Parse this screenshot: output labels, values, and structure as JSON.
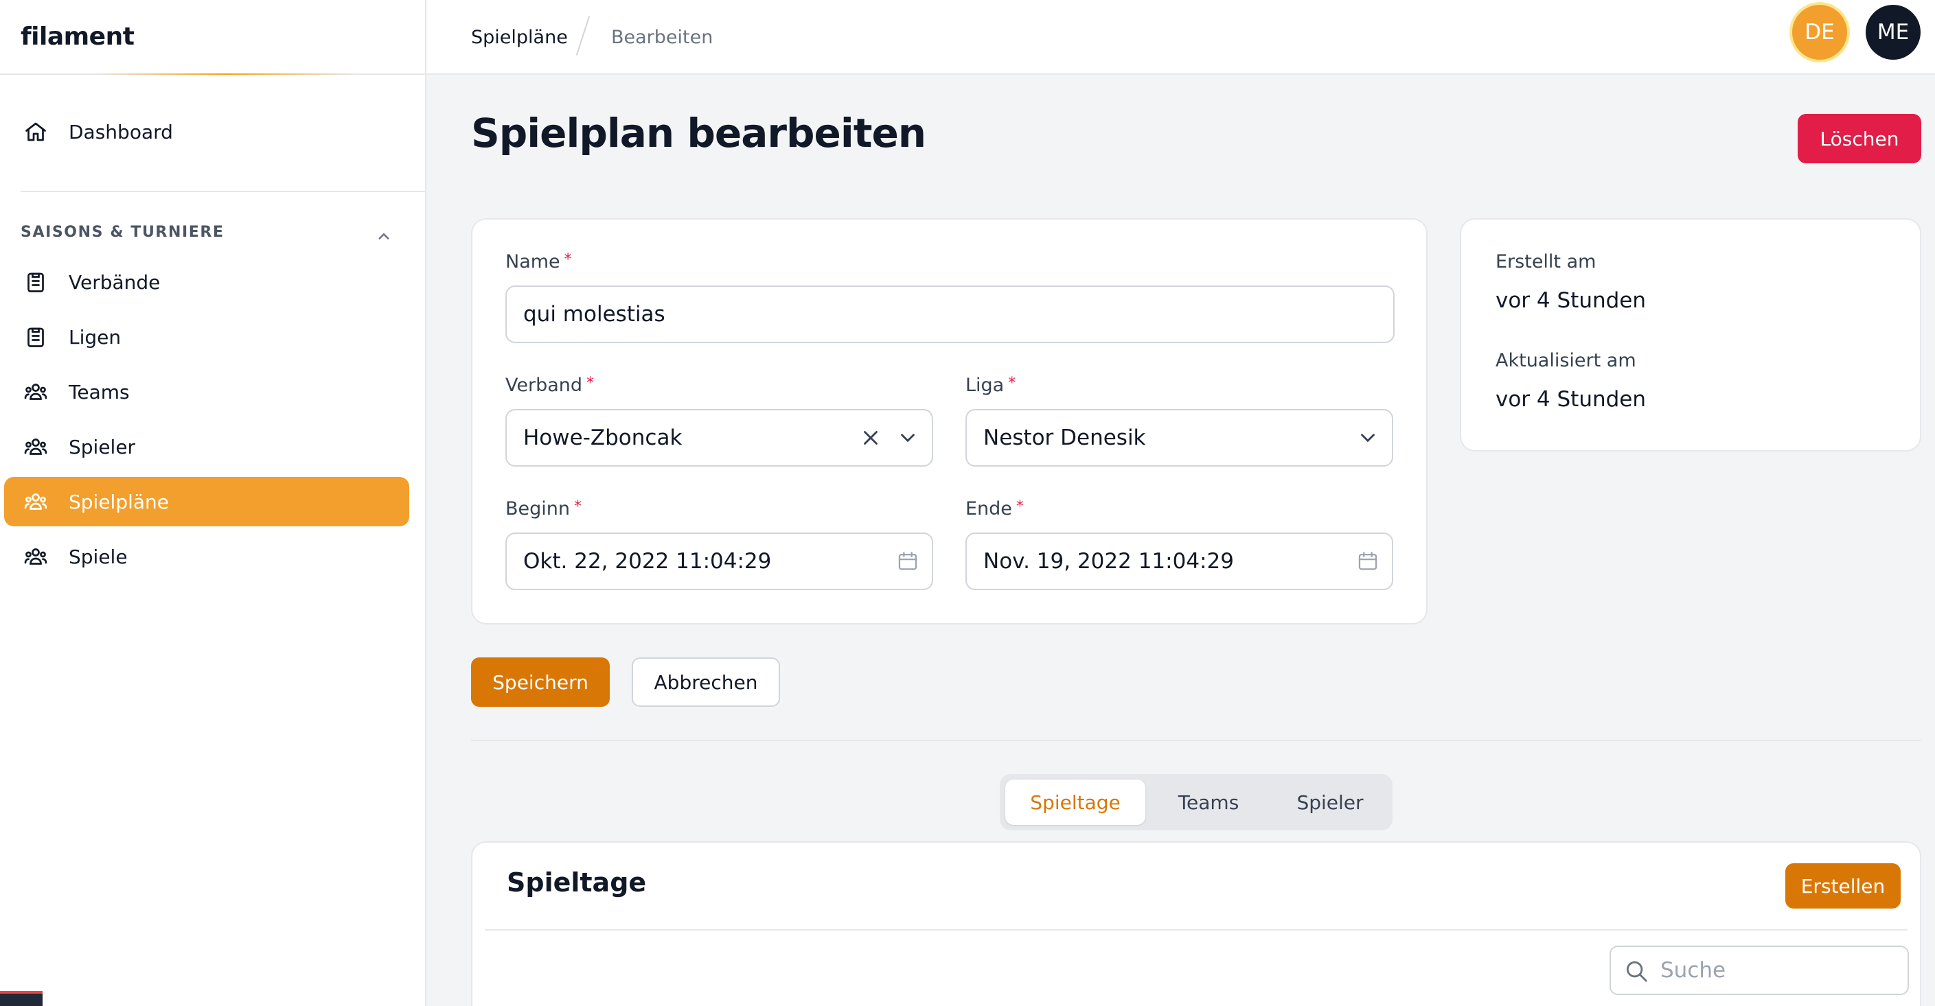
{
  "brand": "filament",
  "sidebar": {
    "dashboard": "Dashboard",
    "group_label": "SAISONS & TURNIERE",
    "items": [
      {
        "label": "Verbände",
        "icon": "clipboard-list-icon"
      },
      {
        "label": "Ligen",
        "icon": "clipboard-list-icon"
      },
      {
        "label": "Teams",
        "icon": "user-group-icon"
      },
      {
        "label": "Spieler",
        "icon": "user-group-icon"
      },
      {
        "label": "Spielpläne",
        "icon": "user-group-icon",
        "active": true
      },
      {
        "label": "Spiele",
        "icon": "user-group-icon"
      }
    ]
  },
  "breadcrumb": {
    "first": "Spielpläne",
    "second": "Bearbeiten"
  },
  "user_menu": {
    "de": "DE",
    "me": "ME"
  },
  "page": {
    "title": "Spielplan bearbeiten",
    "delete_label": "Löschen"
  },
  "form": {
    "name": {
      "label": "Name",
      "value": "qui molestias"
    },
    "verband": {
      "label": "Verband",
      "value": "Howe-Zboncak"
    },
    "liga": {
      "label": "Liga",
      "value": "Nestor Denesik"
    },
    "beginn": {
      "label": "Beginn",
      "value": "Okt. 22, 2022 11:04:29"
    },
    "ende": {
      "label": "Ende",
      "value": "Nov. 19, 2022 11:04:29"
    },
    "required_mark": "*"
  },
  "meta": {
    "created_label": "Erstellt am",
    "created_value": "vor 4 Stunden",
    "updated_label": "Aktualisiert am",
    "updated_value": "vor 4 Stunden"
  },
  "actions": {
    "save": "Speichern",
    "cancel": "Abbrechen"
  },
  "relation_tabs": [
    {
      "label": "Spieltage",
      "active": true
    },
    {
      "label": "Teams",
      "active": false
    },
    {
      "label": "Spieler",
      "active": false
    }
  ],
  "relation": {
    "title": "Spieltage",
    "create_label": "Erstellen",
    "search_placeholder": "Suche"
  },
  "colors": {
    "primary": "#f29f2d",
    "primary_dark": "#d97706",
    "danger": "#e11d48"
  }
}
